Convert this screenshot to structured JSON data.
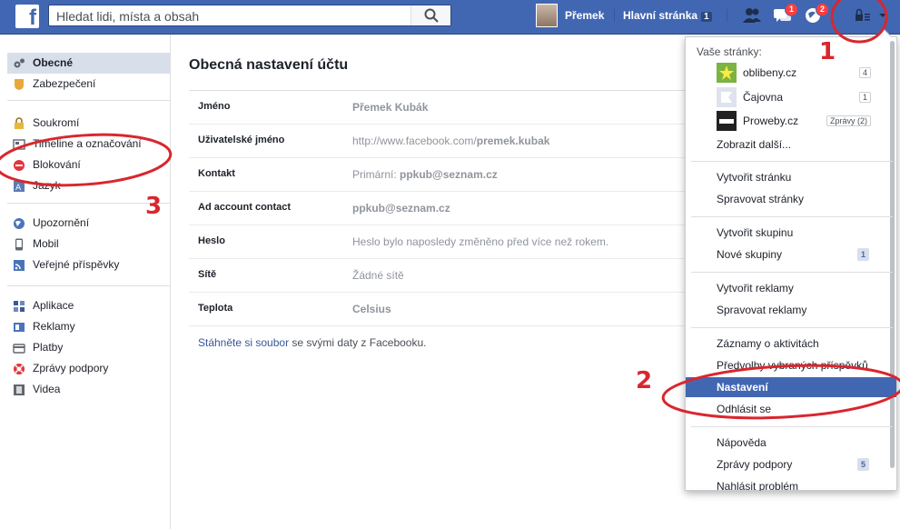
{
  "topbar": {
    "search_placeholder": "Hledat lidi, místa a obsah",
    "profile_name": "Přemek",
    "home_label": "Hlavní stránka",
    "home_count": "1",
    "messages_badge": "1",
    "notifications_badge": "2"
  },
  "leftnav": {
    "group1": [
      {
        "label": "Obecné",
        "icon": "gears-icon"
      },
      {
        "label": "Zabezpečení",
        "icon": "shield-icon"
      }
    ],
    "group2": [
      {
        "label": "Soukromí",
        "icon": "lock-icon"
      },
      {
        "label": "Timeline a označování",
        "icon": "timeline-icon"
      },
      {
        "label": "Blokování",
        "icon": "block-icon"
      },
      {
        "label": "Jazyk",
        "icon": "language-icon"
      }
    ],
    "group3": [
      {
        "label": "Upozornění",
        "icon": "globe-icon"
      },
      {
        "label": "Mobil",
        "icon": "mobile-icon"
      },
      {
        "label": "Veřejné příspěvky",
        "icon": "rss-icon"
      }
    ],
    "group4": [
      {
        "label": "Aplikace",
        "icon": "apps-icon"
      },
      {
        "label": "Reklamy",
        "icon": "ads-icon"
      },
      {
        "label": "Platby",
        "icon": "card-icon"
      },
      {
        "label": "Zprávy podpory",
        "icon": "lifebuoy-icon"
      },
      {
        "label": "Videa",
        "icon": "film-icon"
      }
    ]
  },
  "main": {
    "title": "Obecná nastavení účtu",
    "rows": [
      {
        "label": "Jméno",
        "value_prefix": "",
        "value": "Přemek Kubák"
      },
      {
        "label": "Uživatelské jméno",
        "value_prefix": "http://www.facebook.com/",
        "value": "premek.kubak"
      },
      {
        "label": "Kontakt",
        "value_prefix": "Primární: ",
        "value": "ppkub@seznam.cz"
      },
      {
        "label": "Ad account contact",
        "value_prefix": "",
        "value": "ppkub@seznam.cz"
      },
      {
        "label": "Heslo",
        "value_prefix": "Heslo bylo naposledy změněno před více než rokem.",
        "value": ""
      },
      {
        "label": "Sítě",
        "value_prefix": "Žádné sítě",
        "value": ""
      },
      {
        "label": "Teplota",
        "value_prefix": "",
        "value": "Celsius"
      }
    ],
    "download_link": "Stáhněte si soubor",
    "download_rest": " se svými daty z Facebooku."
  },
  "dropdown": {
    "header": "Vaše stránky:",
    "pages": [
      {
        "name": "oblibeny.cz",
        "count": "4"
      },
      {
        "name": "Čajovna",
        "count": "1"
      },
      {
        "name": "Proweby.cz",
        "count": "Zprávy (2)"
      }
    ],
    "show_more": "Zobrazit další...",
    "create_page": "Vytvořit stránku",
    "manage_pages": "Spravovat stránky",
    "create_group": "Vytvořit skupinu",
    "new_groups": "Nové skupiny",
    "new_groups_count": "1",
    "create_ads": "Vytvořit reklamy",
    "manage_ads": "Spravovat reklamy",
    "activity_log": "Záznamy o aktivitách",
    "news_prefs": "Předvolby vybraných příspěvků",
    "settings": "Nastavení",
    "logout": "Odhlásit se",
    "help": "Nápověda",
    "support_inbox": "Zprávy podpory",
    "support_count": "5",
    "report_problem": "Nahlásit problém"
  },
  "annotations": {
    "n1": "1",
    "n2": "2",
    "n3": "3",
    "color": "#d9262e"
  }
}
